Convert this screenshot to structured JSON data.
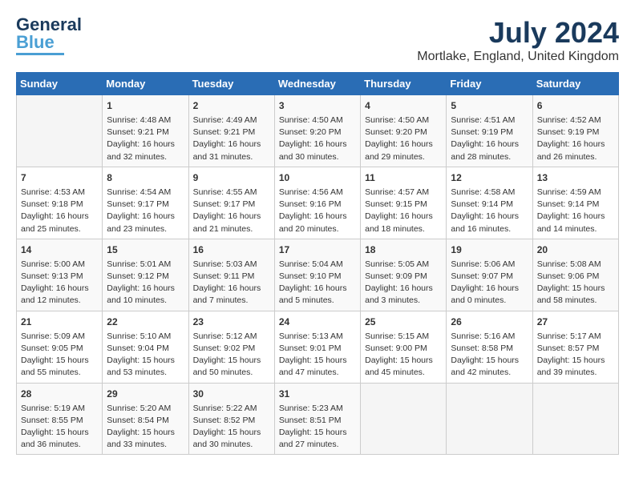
{
  "header": {
    "logo_line1": "General",
    "logo_line2": "Blue",
    "month": "July 2024",
    "location": "Mortlake, England, United Kingdom"
  },
  "days_of_week": [
    "Sunday",
    "Monday",
    "Tuesday",
    "Wednesday",
    "Thursday",
    "Friday",
    "Saturday"
  ],
  "weeks": [
    [
      {
        "day": "",
        "sunrise": "",
        "sunset": "",
        "daylight": ""
      },
      {
        "day": "1",
        "sunrise": "Sunrise: 4:48 AM",
        "sunset": "Sunset: 9:21 PM",
        "daylight": "Daylight: 16 hours and 32 minutes."
      },
      {
        "day": "2",
        "sunrise": "Sunrise: 4:49 AM",
        "sunset": "Sunset: 9:21 PM",
        "daylight": "Daylight: 16 hours and 31 minutes."
      },
      {
        "day": "3",
        "sunrise": "Sunrise: 4:50 AM",
        "sunset": "Sunset: 9:20 PM",
        "daylight": "Daylight: 16 hours and 30 minutes."
      },
      {
        "day": "4",
        "sunrise": "Sunrise: 4:50 AM",
        "sunset": "Sunset: 9:20 PM",
        "daylight": "Daylight: 16 hours and 29 minutes."
      },
      {
        "day": "5",
        "sunrise": "Sunrise: 4:51 AM",
        "sunset": "Sunset: 9:19 PM",
        "daylight": "Daylight: 16 hours and 28 minutes."
      },
      {
        "day": "6",
        "sunrise": "Sunrise: 4:52 AM",
        "sunset": "Sunset: 9:19 PM",
        "daylight": "Daylight: 16 hours and 26 minutes."
      }
    ],
    [
      {
        "day": "7",
        "sunrise": "Sunrise: 4:53 AM",
        "sunset": "Sunset: 9:18 PM",
        "daylight": "Daylight: 16 hours and 25 minutes."
      },
      {
        "day": "8",
        "sunrise": "Sunrise: 4:54 AM",
        "sunset": "Sunset: 9:17 PM",
        "daylight": "Daylight: 16 hours and 23 minutes."
      },
      {
        "day": "9",
        "sunrise": "Sunrise: 4:55 AM",
        "sunset": "Sunset: 9:17 PM",
        "daylight": "Daylight: 16 hours and 21 minutes."
      },
      {
        "day": "10",
        "sunrise": "Sunrise: 4:56 AM",
        "sunset": "Sunset: 9:16 PM",
        "daylight": "Daylight: 16 hours and 20 minutes."
      },
      {
        "day": "11",
        "sunrise": "Sunrise: 4:57 AM",
        "sunset": "Sunset: 9:15 PM",
        "daylight": "Daylight: 16 hours and 18 minutes."
      },
      {
        "day": "12",
        "sunrise": "Sunrise: 4:58 AM",
        "sunset": "Sunset: 9:14 PM",
        "daylight": "Daylight: 16 hours and 16 minutes."
      },
      {
        "day": "13",
        "sunrise": "Sunrise: 4:59 AM",
        "sunset": "Sunset: 9:14 PM",
        "daylight": "Daylight: 16 hours and 14 minutes."
      }
    ],
    [
      {
        "day": "14",
        "sunrise": "Sunrise: 5:00 AM",
        "sunset": "Sunset: 9:13 PM",
        "daylight": "Daylight: 16 hours and 12 minutes."
      },
      {
        "day": "15",
        "sunrise": "Sunrise: 5:01 AM",
        "sunset": "Sunset: 9:12 PM",
        "daylight": "Daylight: 16 hours and 10 minutes."
      },
      {
        "day": "16",
        "sunrise": "Sunrise: 5:03 AM",
        "sunset": "Sunset: 9:11 PM",
        "daylight": "Daylight: 16 hours and 7 minutes."
      },
      {
        "day": "17",
        "sunrise": "Sunrise: 5:04 AM",
        "sunset": "Sunset: 9:10 PM",
        "daylight": "Daylight: 16 hours and 5 minutes."
      },
      {
        "day": "18",
        "sunrise": "Sunrise: 5:05 AM",
        "sunset": "Sunset: 9:09 PM",
        "daylight": "Daylight: 16 hours and 3 minutes."
      },
      {
        "day": "19",
        "sunrise": "Sunrise: 5:06 AM",
        "sunset": "Sunset: 9:07 PM",
        "daylight": "Daylight: 16 hours and 0 minutes."
      },
      {
        "day": "20",
        "sunrise": "Sunrise: 5:08 AM",
        "sunset": "Sunset: 9:06 PM",
        "daylight": "Daylight: 15 hours and 58 minutes."
      }
    ],
    [
      {
        "day": "21",
        "sunrise": "Sunrise: 5:09 AM",
        "sunset": "Sunset: 9:05 PM",
        "daylight": "Daylight: 15 hours and 55 minutes."
      },
      {
        "day": "22",
        "sunrise": "Sunrise: 5:10 AM",
        "sunset": "Sunset: 9:04 PM",
        "daylight": "Daylight: 15 hours and 53 minutes."
      },
      {
        "day": "23",
        "sunrise": "Sunrise: 5:12 AM",
        "sunset": "Sunset: 9:02 PM",
        "daylight": "Daylight: 15 hours and 50 minutes."
      },
      {
        "day": "24",
        "sunrise": "Sunrise: 5:13 AM",
        "sunset": "Sunset: 9:01 PM",
        "daylight": "Daylight: 15 hours and 47 minutes."
      },
      {
        "day": "25",
        "sunrise": "Sunrise: 5:15 AM",
        "sunset": "Sunset: 9:00 PM",
        "daylight": "Daylight: 15 hours and 45 minutes."
      },
      {
        "day": "26",
        "sunrise": "Sunrise: 5:16 AM",
        "sunset": "Sunset: 8:58 PM",
        "daylight": "Daylight: 15 hours and 42 minutes."
      },
      {
        "day": "27",
        "sunrise": "Sunrise: 5:17 AM",
        "sunset": "Sunset: 8:57 PM",
        "daylight": "Daylight: 15 hours and 39 minutes."
      }
    ],
    [
      {
        "day": "28",
        "sunrise": "Sunrise: 5:19 AM",
        "sunset": "Sunset: 8:55 PM",
        "daylight": "Daylight: 15 hours and 36 minutes."
      },
      {
        "day": "29",
        "sunrise": "Sunrise: 5:20 AM",
        "sunset": "Sunset: 8:54 PM",
        "daylight": "Daylight: 15 hours and 33 minutes."
      },
      {
        "day": "30",
        "sunrise": "Sunrise: 5:22 AM",
        "sunset": "Sunset: 8:52 PM",
        "daylight": "Daylight: 15 hours and 30 minutes."
      },
      {
        "day": "31",
        "sunrise": "Sunrise: 5:23 AM",
        "sunset": "Sunset: 8:51 PM",
        "daylight": "Daylight: 15 hours and 27 minutes."
      },
      {
        "day": "",
        "sunrise": "",
        "sunset": "",
        "daylight": ""
      },
      {
        "day": "",
        "sunrise": "",
        "sunset": "",
        "daylight": ""
      },
      {
        "day": "",
        "sunrise": "",
        "sunset": "",
        "daylight": ""
      }
    ]
  ]
}
